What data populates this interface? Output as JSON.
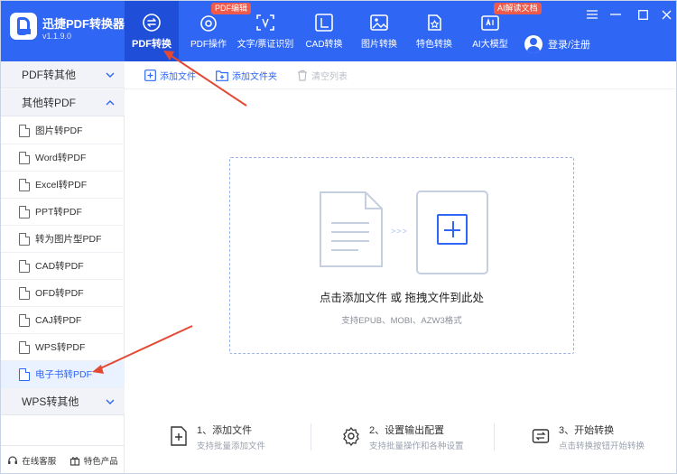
{
  "app": {
    "name": "迅捷PDF转换器",
    "version": "v1.1.9.0"
  },
  "nav": {
    "tabs": [
      {
        "label": "PDF转换",
        "icon": "convert-icon",
        "active": true
      },
      {
        "label": "PDF操作",
        "icon": "pdf-operation-icon",
        "badge": "PDF编辑"
      },
      {
        "label": "文字/票证识别",
        "icon": "ocr-scan-icon"
      },
      {
        "label": "CAD转换",
        "icon": "cad-icon"
      },
      {
        "label": "图片转换",
        "icon": "image-icon"
      },
      {
        "label": "特色转换",
        "icon": "star-doc-icon"
      },
      {
        "label": "AI大模型",
        "icon": "ai-model-icon",
        "badge": "AI解读文档"
      }
    ],
    "login_label": "登录/注册"
  },
  "sidebar": {
    "categories": [
      {
        "label": "PDF转其他",
        "expanded": false
      },
      {
        "label": "其他转PDF",
        "expanded": true
      },
      {
        "label": "WPS转其他",
        "expanded": false
      }
    ],
    "items": [
      {
        "label": "图片转PDF",
        "icon": "image-file-icon"
      },
      {
        "label": "Word转PDF",
        "icon": "word-file-icon"
      },
      {
        "label": "Excel转PDF",
        "icon": "excel-file-icon"
      },
      {
        "label": "PPT转PDF",
        "icon": "ppt-file-icon"
      },
      {
        "label": "转为图片型PDF",
        "icon": "image-pdf-file-icon"
      },
      {
        "label": "CAD转PDF",
        "icon": "cad-file-icon"
      },
      {
        "label": "OFD转PDF",
        "icon": "ofd-file-icon"
      },
      {
        "label": "CAJ转PDF",
        "icon": "caj-file-icon"
      },
      {
        "label": "WPS转PDF",
        "icon": "wps-file-icon"
      },
      {
        "label": "电子书转PDF",
        "icon": "ebook-file-icon",
        "active": true
      }
    ],
    "footer": {
      "support_label": "在线客服",
      "features_label": "特色产品"
    }
  },
  "toolbar": {
    "add_file": "添加文件",
    "add_folder": "添加文件夹",
    "clear_list": "清空列表"
  },
  "dropzone": {
    "main_text": "点击添加文件 或 拖拽文件到此处",
    "formats_text": "支持EPUB、MOBI、AZW3格式"
  },
  "steps": [
    {
      "title": "1、添加文件",
      "desc": "支持批量添加文件",
      "icon": "add-file-icon"
    },
    {
      "title": "2、设置输出配置",
      "desc": "支持批量操作和各种设置",
      "icon": "settings-gear-icon"
    },
    {
      "title": "3、开始转换",
      "desc": "点击转换按钮开始转换",
      "icon": "convert-start-icon"
    }
  ],
  "colors": {
    "primary": "#2f66f3",
    "active_tab": "#1f4fd8",
    "badge": "#f05a4a",
    "sidebar_active_bg": "#eaf1ff"
  }
}
